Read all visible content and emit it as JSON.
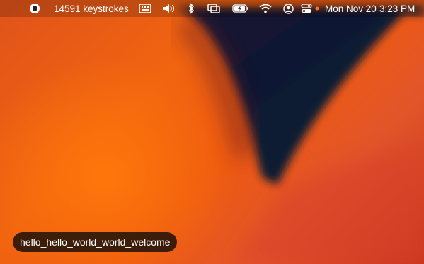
{
  "menubar": {
    "keystrokes_label": "14591 keystrokes",
    "date": "Mon Nov 20",
    "time": "3:23 PM",
    "icons": [
      "record-stop-icon",
      "keyboard-input-icon",
      "volume-icon",
      "bluetooth-icon",
      "screen-mirroring-icon",
      "battery-charging-icon",
      "wifi-icon",
      "user-account-icon",
      "control-center-icon"
    ],
    "indicator_color": "#f47a2a"
  },
  "keystroke_overlay": {
    "text": "hello_hello_world_world_welcome"
  },
  "wallpaper": {
    "colors": [
      "#f16410",
      "#0b1a30",
      "#e2552a"
    ]
  }
}
